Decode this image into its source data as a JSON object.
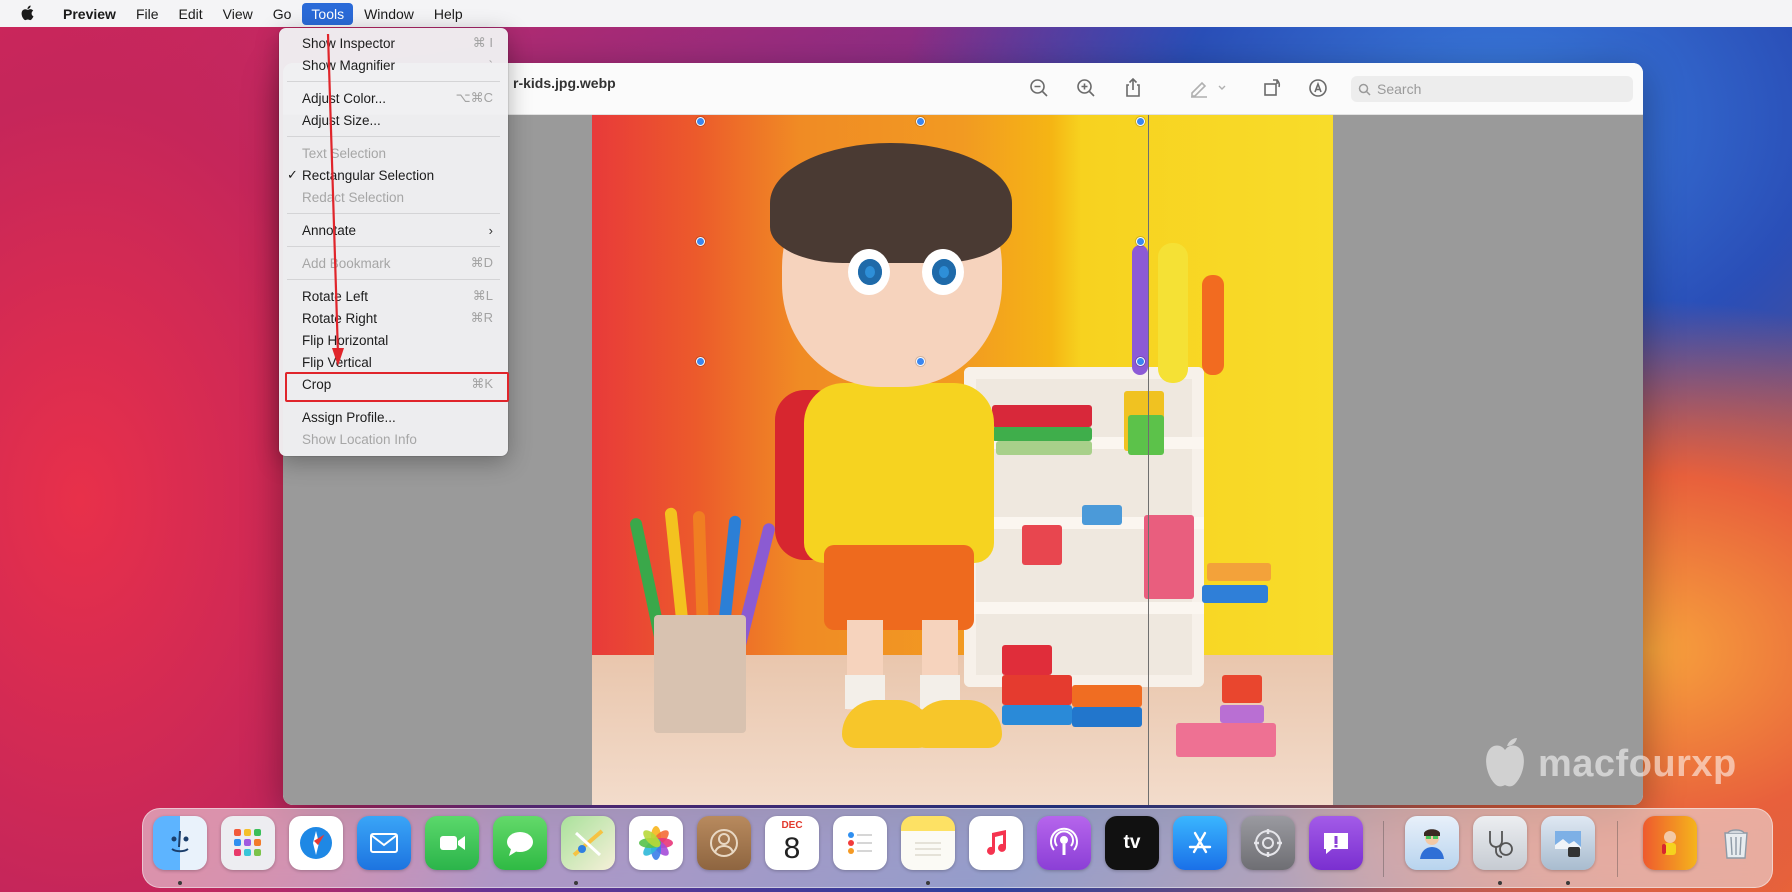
{
  "menubar": {
    "app_name": "Preview",
    "items": [
      "File",
      "Edit",
      "View",
      "Go",
      "Tools",
      "Window",
      "Help"
    ],
    "active_item": "Tools"
  },
  "window": {
    "title": "r-kids.jpg.webp",
    "search_placeholder": "Search",
    "toolbar_icons": [
      "zoom-out-icon",
      "zoom-in-icon",
      "share-icon",
      "markup-pen-icon",
      "rotate-icon",
      "annotate-icon"
    ]
  },
  "tools_menu": {
    "items": [
      {
        "label": "Show Inspector",
        "shortcut": "⌘ I"
      },
      {
        "label": "Show Magnifier",
        "shortcut": "`"
      },
      {
        "label": "Adjust Color...",
        "shortcut": "⌥⌘C"
      },
      {
        "label": "Adjust Size...",
        "shortcut": ""
      },
      {
        "label": "Text Selection",
        "shortcut": "",
        "disabled": true
      },
      {
        "label": "Rectangular Selection",
        "shortcut": "",
        "checked": true
      },
      {
        "label": "Redact Selection",
        "shortcut": "",
        "disabled": true
      },
      {
        "label": "Annotate",
        "shortcut": "",
        "submenu": true
      },
      {
        "label": "Add Bookmark",
        "shortcut": "⌘D",
        "disabled": true
      },
      {
        "label": "Rotate Left",
        "shortcut": "⌘L"
      },
      {
        "label": "Rotate Right",
        "shortcut": "⌘R"
      },
      {
        "label": "Flip Horizontal",
        "shortcut": ""
      },
      {
        "label": "Flip Vertical",
        "shortcut": ""
      },
      {
        "label": "Crop",
        "shortcut": "⌘K",
        "highlighted": true
      },
      {
        "label": "Assign Profile...",
        "shortcut": ""
      },
      {
        "label": "Show Location Info",
        "shortcut": "",
        "disabled": true
      }
    ],
    "check_glyph": "✓",
    "submenu_glyph": "›"
  },
  "watermark": {
    "text": "macfourxp"
  },
  "dock": {
    "apps": [
      {
        "name": "Finder",
        "icon": "finder-icon",
        "color": "#2f8ff0"
      },
      {
        "name": "Launchpad",
        "icon": "launchpad-icon",
        "color": "#e9e9ee"
      },
      {
        "name": "Safari",
        "icon": "safari-icon",
        "color": "#1e88e5"
      },
      {
        "name": "Mail",
        "icon": "mail-icon",
        "color": "#2d8cf0"
      },
      {
        "name": "FaceTime",
        "icon": "facetime-icon",
        "color": "#33c14c"
      },
      {
        "name": "Messages",
        "icon": "messages-icon",
        "color": "#35c84a"
      },
      {
        "name": "Maps",
        "icon": "maps-icon",
        "color": "#6fc16e"
      },
      {
        "name": "Photos",
        "icon": "photos-icon",
        "color": "#ffffff"
      },
      {
        "name": "Contacts",
        "icon": "contacts-icon",
        "color": "#a57a52"
      },
      {
        "name": "Calendar",
        "icon": "calendar-icon",
        "color": "#ffffff"
      },
      {
        "name": "Reminders",
        "icon": "reminders-icon",
        "color": "#ffffff"
      },
      {
        "name": "Notes",
        "icon": "notes-icon",
        "color": "#fde164"
      },
      {
        "name": "Music",
        "icon": "music-icon",
        "color": "#ffffff"
      },
      {
        "name": "Podcasts",
        "icon": "podcasts-icon",
        "color": "#9a4ce0"
      },
      {
        "name": "TV",
        "icon": "apple-tv-icon",
        "color": "#111111"
      },
      {
        "name": "App Store",
        "icon": "app-store-icon",
        "color": "#1f8cf2"
      },
      {
        "name": "System Preferences",
        "icon": "system-preferences-icon",
        "color": "#8e8e93"
      },
      {
        "name": "Feedback Assistant",
        "icon": "feedback-assistant-icon",
        "color": "#8e3fd6"
      },
      {
        "name": "Doctor App",
        "icon": "doctor-app-icon",
        "color": "#e6eef6"
      },
      {
        "name": "Disk Utility",
        "icon": "disk-utility-icon",
        "color": "#d8dbe0"
      },
      {
        "name": "Preview",
        "icon": "preview-icon",
        "color": "#cfd8e4"
      },
      {
        "name": "Image File",
        "icon": "image-file-icon",
        "color": "#f2a33a"
      },
      {
        "name": "Trash",
        "icon": "trash-icon",
        "color": "#e6e8ea"
      }
    ],
    "calendar": {
      "month": "DEC",
      "day": "8"
    },
    "tv_label": "tv"
  },
  "colors": {
    "menu_highlight": "#2a6ad8",
    "annotation_red": "#e0252b",
    "selection_handle": "#3a86f0"
  }
}
